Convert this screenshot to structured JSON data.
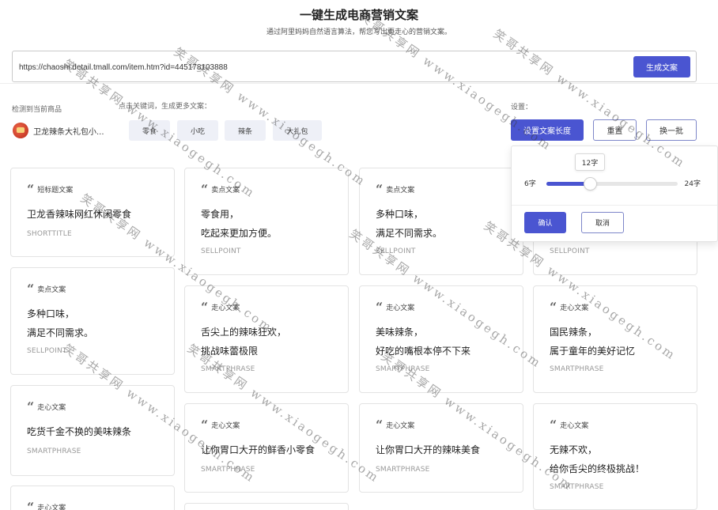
{
  "header": {
    "title": "一键生成电商营销文案",
    "subtitle": "通过阿里妈妈自然语言算法，帮您写出更走心的营销文案。"
  },
  "url_bar": {
    "value": "https://chaoshi.detail.tmall.com/item.htm?id=445178103888",
    "generate_label": "生成文案"
  },
  "detected": {
    "label": "检测到当前商品",
    "product_name": "卫龙辣条大礼包小..."
  },
  "keywords": {
    "label": "点击关键词，生成更多文案：",
    "items": [
      "零食",
      "小吃",
      "辣条",
      "大礼包"
    ]
  },
  "settings": {
    "label": "设置：",
    "length_button": "设置文案长度",
    "reset_button": "重置",
    "refresh_button": "换一批"
  },
  "popover": {
    "current": "12字",
    "min_label": "6字",
    "max_label": "24字",
    "min": 6,
    "max": 24,
    "value": 12,
    "ok_label": "确认",
    "cancel_label": "取消"
  },
  "cards": [
    {
      "type": "短标题文案",
      "lines": [
        "卫龙香辣味网红休闲零食"
      ],
      "code": "SHORTTITLE"
    },
    {
      "type": "卖点文案",
      "lines": [
        "零食用，",
        "吃起来更加方便。"
      ],
      "code": "SELLPOINT"
    },
    {
      "type": "卖点文案",
      "lines": [
        "多种口味，",
        "满足不同需求。"
      ],
      "code": "SELLPOINT"
    },
    {
      "type": "卖点文案",
      "lines": [
        "",
        ""
      ],
      "code": "SELLPOINT"
    },
    {
      "type": "卖点文案",
      "lines": [
        "多种口味，",
        "满足不同需求。"
      ],
      "code": "SELLPOINT"
    },
    {
      "type": "走心文案",
      "lines": [
        "舌尖上的辣味狂欢，",
        "挑战味蕾极限"
      ],
      "code": "SMARTPHRASE"
    },
    {
      "type": "走心文案",
      "lines": [
        "美味辣条，",
        "好吃的嘴根本停不下来"
      ],
      "code": "SMARTPHRASE"
    },
    {
      "type": "走心文案",
      "lines": [
        "国民辣条，",
        "属于童年的美好记忆"
      ],
      "code": "SMARTPHRASE"
    },
    {
      "type": "走心文案",
      "lines": [
        "吃货千金不换的美味辣条"
      ],
      "code": "SMARTPHRASE"
    },
    {
      "type": "走心文案",
      "lines": [
        "让你胃口大开的鲜香小零食"
      ],
      "code": "SMARTPHRASE"
    },
    {
      "type": "走心文案",
      "lines": [
        "让你胃口大开的辣味美食"
      ],
      "code": "SMARTPHRASE"
    },
    {
      "type": "走心文案",
      "lines": [
        "无辣不欢，",
        "给你舌尖的终极挑战！"
      ],
      "code": "SMARTPHRASE"
    },
    {
      "type": "走心文案",
      "lines": [],
      "code": ""
    }
  ],
  "watermark": {
    "name": "笑哥共享网",
    "site": "www.xiaogegh.com"
  },
  "colors": {
    "accent": "#4a55d1",
    "tag_bg": "#eef0f7"
  }
}
